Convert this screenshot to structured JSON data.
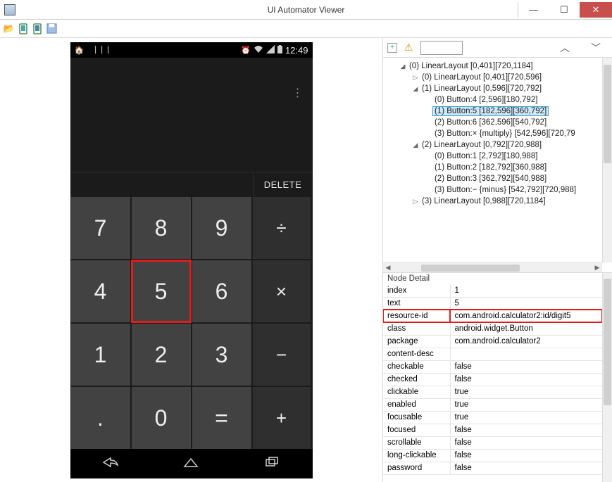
{
  "window": {
    "title": "UI Automator Viewer"
  },
  "statusbar": {
    "time": "12:49"
  },
  "calc": {
    "delete_label": "DELETE",
    "keys": [
      {
        "label": "7",
        "op": false
      },
      {
        "label": "8",
        "op": false
      },
      {
        "label": "9",
        "op": false
      },
      {
        "label": "÷",
        "op": true
      },
      {
        "label": "4",
        "op": false
      },
      {
        "label": "5",
        "op": false,
        "selected": true
      },
      {
        "label": "6",
        "op": false
      },
      {
        "label": "×",
        "op": true
      },
      {
        "label": "1",
        "op": false
      },
      {
        "label": "2",
        "op": false
      },
      {
        "label": "3",
        "op": false
      },
      {
        "label": "−",
        "op": true
      },
      {
        "label": ".",
        "op": false
      },
      {
        "label": "0",
        "op": false
      },
      {
        "label": "=",
        "op": false
      },
      {
        "label": "+",
        "op": true
      }
    ]
  },
  "tree": {
    "nodes": [
      {
        "indent": 1,
        "arrow": "◢",
        "text": "(0) LinearLayout [0,401][720,1184]"
      },
      {
        "indent": 2,
        "arrow": "▷",
        "text": "(0) LinearLayout [0,401][720,596]"
      },
      {
        "indent": 2,
        "arrow": "◢",
        "text": "(1) LinearLayout [0,596][720,792]"
      },
      {
        "indent": 3,
        "arrow": "",
        "text": "(0) Button:4 [2,596][180,792]"
      },
      {
        "indent": 3,
        "arrow": "",
        "text": "(1) Button:5 [182,596][360,792]",
        "selected": true
      },
      {
        "indent": 3,
        "arrow": "",
        "text": "(2) Button:6 [362,596][540,792]"
      },
      {
        "indent": 3,
        "arrow": "",
        "text": "(3) Button:× {multiply} [542,596][720,79"
      },
      {
        "indent": 2,
        "arrow": "◢",
        "text": "(2) LinearLayout [0,792][720,988]"
      },
      {
        "indent": 3,
        "arrow": "",
        "text": "(0) Button:1 [2,792][180,988]"
      },
      {
        "indent": 3,
        "arrow": "",
        "text": "(1) Button:2 [182,792][360,988]"
      },
      {
        "indent": 3,
        "arrow": "",
        "text": "(2) Button:3 [362,792][540,988]"
      },
      {
        "indent": 3,
        "arrow": "",
        "text": "(3) Button:− {minus} [542,792][720,988]"
      },
      {
        "indent": 2,
        "arrow": "▷",
        "text": "(3) LinearLayout [0,988][720,1184]"
      }
    ]
  },
  "detail": {
    "header": "Node Detail",
    "rows": [
      {
        "key": "index",
        "value": "1"
      },
      {
        "key": "text",
        "value": "5"
      },
      {
        "key": "resource-id",
        "value": "com.android.calculator2:id/digit5",
        "hl": true
      },
      {
        "key": "class",
        "value": "android.widget.Button"
      },
      {
        "key": "package",
        "value": "com.android.calculator2"
      },
      {
        "key": "content-desc",
        "value": ""
      },
      {
        "key": "checkable",
        "value": "false"
      },
      {
        "key": "checked",
        "value": "false"
      },
      {
        "key": "clickable",
        "value": "true"
      },
      {
        "key": "enabled",
        "value": "true"
      },
      {
        "key": "focusable",
        "value": "true"
      },
      {
        "key": "focused",
        "value": "false"
      },
      {
        "key": "scrollable",
        "value": "false"
      },
      {
        "key": "long-clickable",
        "value": "false"
      },
      {
        "key": "password",
        "value": "false"
      }
    ]
  }
}
